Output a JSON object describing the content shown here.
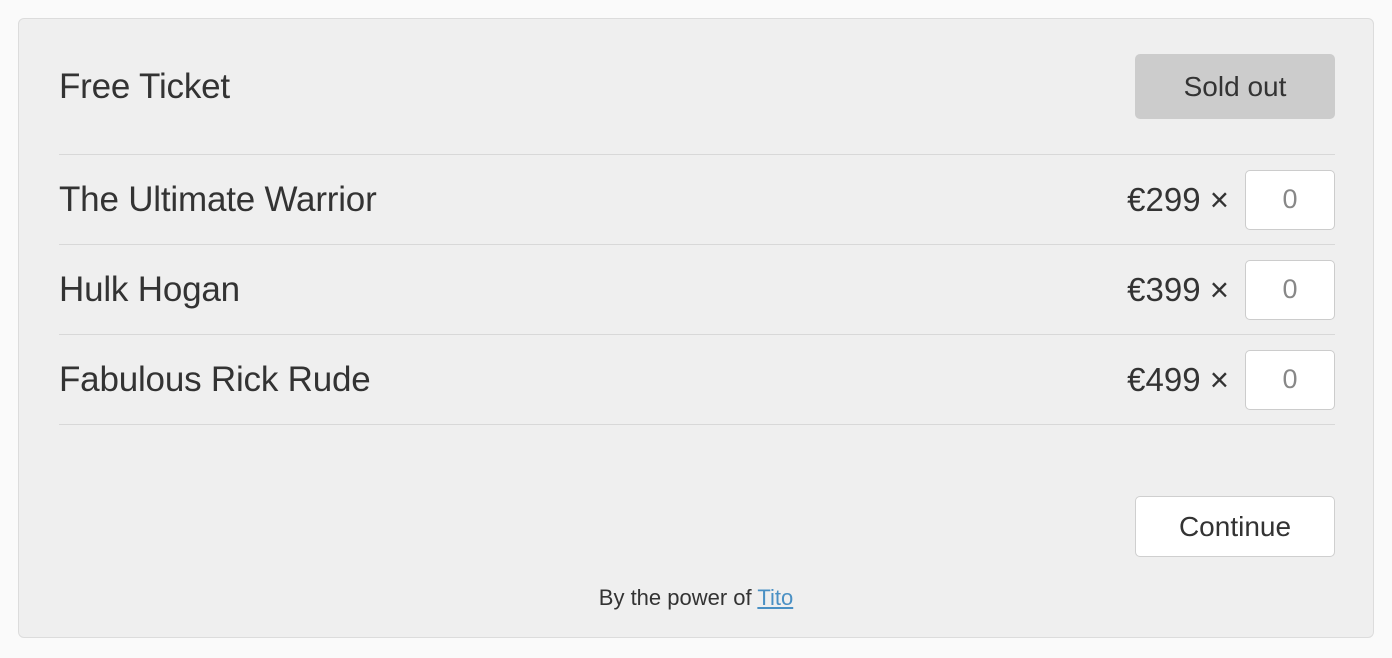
{
  "widget": {
    "tickets": [
      {
        "name": "Free Ticket",
        "type": "sold-out",
        "action_label": "Sold out"
      },
      {
        "name": "The Ultimate Warrior",
        "type": "purchasable",
        "price": "€299 ×",
        "quantity_value": "",
        "quantity_placeholder": "0"
      },
      {
        "name": "Hulk Hogan",
        "type": "purchasable",
        "price": "€399 ×",
        "quantity_value": "",
        "quantity_placeholder": "0"
      },
      {
        "name": "Fabulous Rick Rude",
        "type": "purchasable",
        "price": "€499 ×",
        "quantity_value": "",
        "quantity_placeholder": "0"
      }
    ],
    "continue_label": "Continue",
    "footer": {
      "prefix": "By the power of ",
      "link_label": "Tito"
    }
  },
  "colors": {
    "page_background": "#fafafa",
    "card_background": "#efefef",
    "card_border": "#dcdcdc",
    "separator": "#d8d8d8",
    "text": "#333333",
    "sold_out_background": "#cccccc",
    "link": "#4a90c4",
    "input_background": "#ffffff",
    "input_border": "#cccccc"
  }
}
